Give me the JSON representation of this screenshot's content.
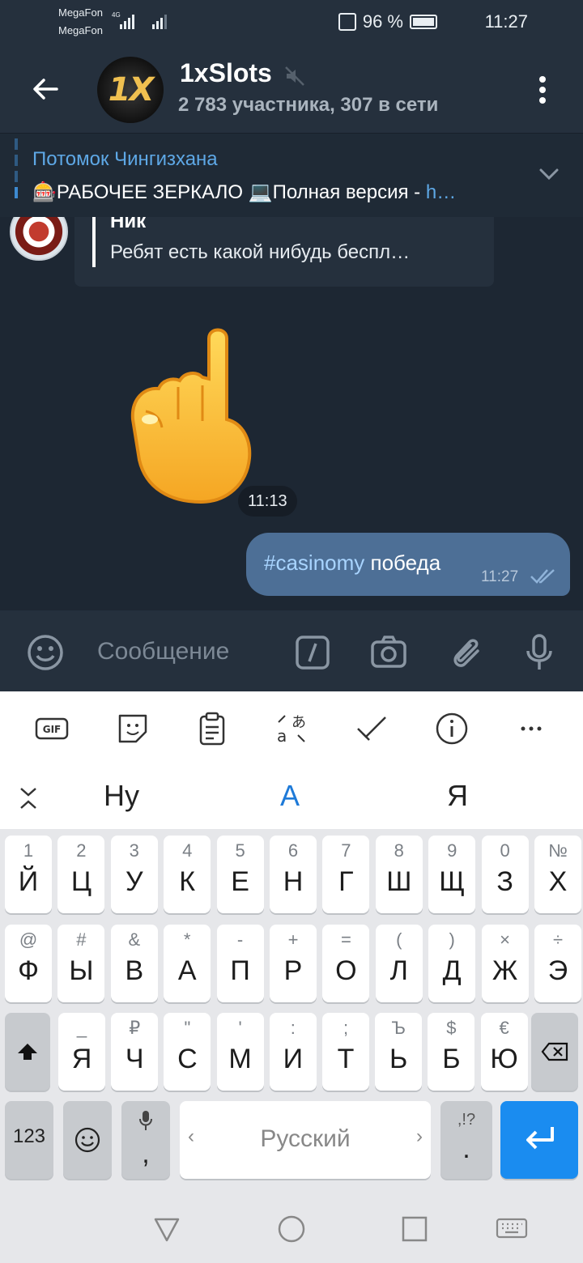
{
  "status_bar": {
    "carrier_1": "MegaFon",
    "carrier_2": "MegaFon",
    "network_tag": "4G",
    "battery": "96 %",
    "time": "11:27"
  },
  "header": {
    "back_icon": "arrow-left-icon",
    "avatar_text": "1X",
    "title": "1xSlots",
    "mute_icon": "muted-speaker-icon",
    "subtitle": "2 783 участника, 307 в сети",
    "menu_icon": "more-vertical-icon"
  },
  "pinned": {
    "author": "Потомок Чингизхана",
    "text_prefix": "🎰РАБОЧЕЕ ЗЕРКАЛО  💻Полная версия  - ",
    "text_link": "h…",
    "expand_icon": "chevron-down-icon"
  },
  "chat": {
    "reply": {
      "name": "Ник",
      "text": "Ребят есть какой нибудь беспл…"
    },
    "sticker_time": "11:13",
    "outgoing": {
      "hashtag": "#casinomy",
      "text": " победа",
      "time": "11:27"
    }
  },
  "input": {
    "placeholder": "Сообщение"
  },
  "suggestions": [
    "Ну",
    "А",
    "Я"
  ],
  "keyboard": {
    "row1": [
      [
        "1",
        "Й"
      ],
      [
        "2",
        "Ц"
      ],
      [
        "3",
        "У"
      ],
      [
        "4",
        "К"
      ],
      [
        "5",
        "Е"
      ],
      [
        "6",
        "Н"
      ],
      [
        "7",
        "Г"
      ],
      [
        "8",
        "Ш"
      ],
      [
        "9",
        "Щ"
      ],
      [
        "0",
        "З"
      ],
      [
        "№",
        "Х"
      ]
    ],
    "row2": [
      [
        "@",
        "Ф"
      ],
      [
        "#",
        "Ы"
      ],
      [
        "&",
        "В"
      ],
      [
        "*",
        "А"
      ],
      [
        "-",
        "П"
      ],
      [
        "+",
        "Р"
      ],
      [
        "=",
        "О"
      ],
      [
        "(",
        "Л"
      ],
      [
        ")",
        "Д"
      ],
      [
        "×",
        "Ж"
      ],
      [
        "÷",
        "Э"
      ]
    ],
    "row3": [
      [
        "_",
        "Я"
      ],
      [
        "₽",
        "Ч"
      ],
      [
        "\"",
        "С"
      ],
      [
        "'",
        "М"
      ],
      [
        ":",
        "И"
      ],
      [
        ";",
        "Т"
      ],
      [
        "Ъ",
        "Ь"
      ],
      [
        "$",
        "Б"
      ],
      [
        "€",
        "Ю"
      ]
    ],
    "num_key": "123",
    "comma": ",",
    "space_label": "Русский",
    "punct_sub": ",!?",
    "punct_main": "."
  },
  "colors": {
    "header_bg": "#25303d",
    "chat_bg": "#1d2733",
    "accent": "#5ea8e6",
    "outgoing_bubble": "#4d6f96",
    "enter_key": "#1a8cf0"
  }
}
